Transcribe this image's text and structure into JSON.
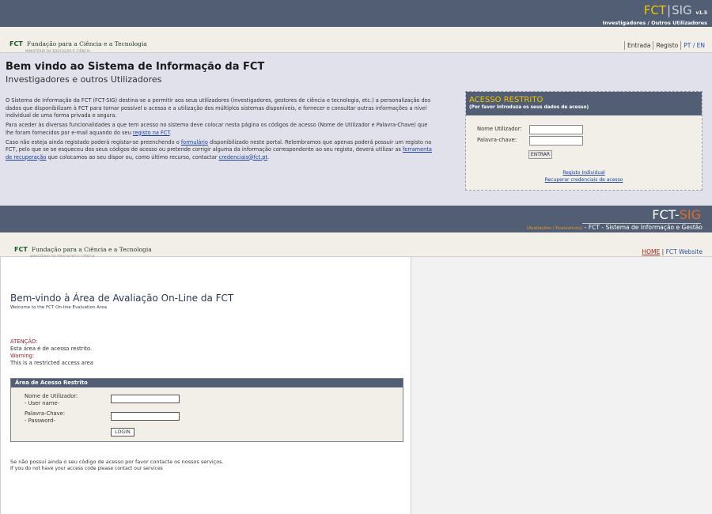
{
  "upper": {
    "logo": {
      "brand_left": "FCT",
      "brand_sep": "|",
      "brand_right": "SIG",
      "version": "v1.5",
      "subtitle": "Investigadores / Outros Utilizadores"
    },
    "org": {
      "acronym": "FCT",
      "name": "Fundação para a Ciência e a Tecnologia",
      "ministry": "MINISTÉRIO DA EDUCAÇÃO E CIÊNCIA"
    },
    "nav": {
      "entrada": "Entrada",
      "registo": "Registo",
      "lang": "PT / EN"
    },
    "welcome_title": "Bem vindo ao Sistema de Informação da FCT",
    "welcome_subtitle": "Investigadores e outros Utilizadores",
    "intro": {
      "p1": "O Sistema de Informação da FCT (FCT-SIG) destina-se a permitir aos seus utilizadores (investigadores, gestores de ciência e tecnologia, etc.) a personalização dos dados que disponibilizam à FCT para tornar possível o acesso e a utilização dos múltiplos sistemas disponíveis, e fornecer e consultar outras informações a nível individual de uma forma privada e segura.",
      "p2_before": "Para aceder às diversas funcionalidades a que tem acesso no sistema deve colocar nesta página os códigos de acesso (Nome de Utilizador e Palavra-Chave) que lhe foram fornecidos por e-mail aquando do seu ",
      "p2_link": "registo na FCT",
      "p2_after": ".",
      "p3_a": "Caso não esteja ainda registado poderá registar-se preenchendo o ",
      "p3_link1": "formulário",
      "p3_b": " disponibilizado neste portal. Relembramos que apenas poderá possuir um registo na FCT, pelo que se se esqueceu dos seus códigos de acesso ou pretende corrigir alguma da informação correspondente ao seu registo, deverá utilizar as ",
      "p3_link2": "ferramenta de recuperação",
      "p3_c": " que colocamos ao seu dispor ou, como último recurso, contactar ",
      "p3_link3": "credenciais@fct.pt",
      "p3_d": "."
    },
    "login": {
      "title": "ACESSO RESTRITO",
      "subtitle": "(Por favor introduza os seus dados de acesso)",
      "user_label": "Nome Utilizador:",
      "pass_label": "Palavra-chave:",
      "user_value": "",
      "pass_value": "",
      "button": "ENTRAR",
      "link_register": "Registo Individual",
      "link_recover": "Recuperar credenciais de acesso"
    }
  },
  "lower": {
    "logo": {
      "brand_left": "FCT-",
      "brand_right": "SIG",
      "aval": "(Avaliações / Evaluations)",
      "subtitle": " - FCT - Sistema de Informação e Gestão"
    },
    "org": {
      "acronym": "FCT",
      "name": "Fundação para a Ciência e a Tecnologia",
      "ministry": "MINISTÉRIO DA EDUCAÇÃO E CIÊNCIA"
    },
    "nav": {
      "home": "HOME",
      "sep": "|",
      "website": "FCT Website"
    },
    "title": "Bem-vindo à Área de Avaliação On-Line da FCT",
    "subtitle": "Welcome to the FCT On-line Evaluation Area",
    "warnings": {
      "atencao": "ATENÇÃO:",
      "atencao_text": "Esta área é de acesso restrito.",
      "warning": "Warning:",
      "warning_text": "This is a restricted access area"
    },
    "form": {
      "title": "Área de Acesso Restrito",
      "user_label_pt": "Nome de Utilizador:",
      "user_label_en": "- User name-",
      "pass_label_pt": "Palavra-Chave:",
      "pass_label_en": "- Password-",
      "user_value": "",
      "pass_value": "",
      "button": "LOGIN"
    },
    "note_pt": "Se não possui ainda o seu código de acesso por favor contacte os nossos serviços.",
    "note_en": "If you do not have your access code please contact our services"
  }
}
